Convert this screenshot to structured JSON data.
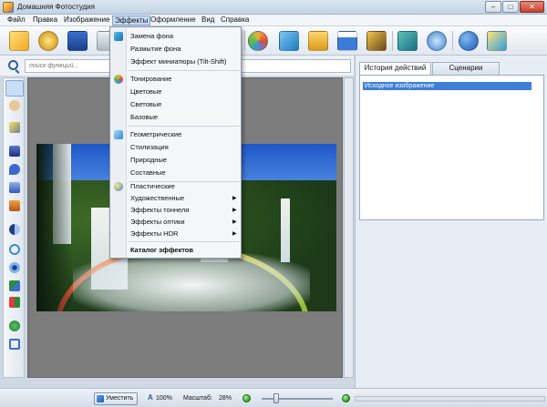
{
  "window": {
    "title": "Домашняя Фотостудия",
    "minimize": "–",
    "maximize": "□",
    "close": "✕"
  },
  "menu": [
    "Файл",
    "Правка",
    "Изображение",
    "Эффекты",
    "Оформление",
    "Вид",
    "Справка"
  ],
  "search": {
    "placeholder": "поиск функций..."
  },
  "effects_menu": {
    "items": [
      {
        "label": "Замена фона",
        "icon": "background-replace-icon"
      },
      {
        "label": "Размытие фона"
      },
      {
        "label": "Эффект миниатюры (Tilt-Shift)"
      },
      {
        "label": "Тонирование",
        "icon": "toning-icon"
      },
      {
        "label": "Цветовые"
      },
      {
        "label": "Световые"
      },
      {
        "label": "Базовые"
      },
      {
        "label": "Геометрические",
        "icon": "geometric-icon"
      },
      {
        "label": "Стилизация"
      },
      {
        "label": "Природные"
      },
      {
        "label": "Составные"
      },
      {
        "label": "Пластические",
        "icon": "plastic-icon"
      },
      {
        "label": "Художественные",
        "submenu": true
      },
      {
        "label": "Эффекты тоннеля",
        "submenu": true
      },
      {
        "label": "Эффекты оптики",
        "submenu": true
      },
      {
        "label": "Эффекты HDR",
        "submenu": true
      },
      {
        "label": "Каталог эффектов",
        "bold": true
      }
    ]
  },
  "right_panel": {
    "tabs": [
      "История действий",
      "Сценарии"
    ],
    "history": [
      "Исходное изображение"
    ]
  },
  "statusbar": {
    "zoom_button": "Уместить",
    "zoom": "100%",
    "scale_label": "Масштаб:",
    "scale_value": "28%"
  },
  "toolbar_icons": [
    "open-folder-icon",
    "gallery-icon",
    "save-icon",
    "print-icon",
    "palette-icon",
    "frame-icon",
    "picture-frame-icon",
    "calendar-icon",
    "collage-icon",
    "crop-resize-icon",
    "one-to-one-icon",
    "help-icon",
    "box-icon"
  ],
  "left_tools": [
    "pointer-icon",
    "hand-icon",
    "magic-wand-icon",
    "brush-icon",
    "drop-icon",
    "fill-icon",
    "stamp-icon",
    "circle-select-icon",
    "lasso-icon",
    "eye-icon",
    "layers-icon",
    "eraser-icon",
    "crop-icon"
  ]
}
